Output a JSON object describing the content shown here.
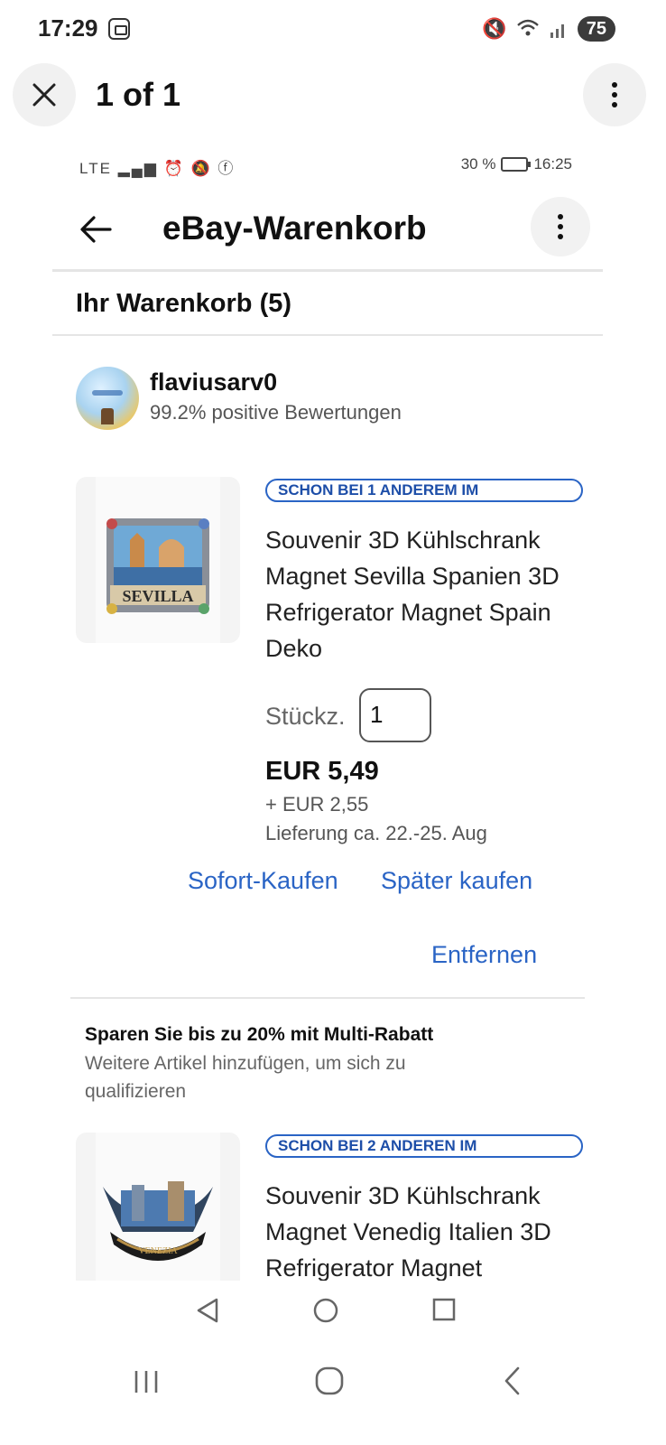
{
  "outer_status": {
    "time": "17:29",
    "battery": "75"
  },
  "viewer": {
    "title": "1 of 1"
  },
  "inner_status": {
    "signal": "LTE",
    "battery": "30 %",
    "time": "16:25"
  },
  "header": {
    "title": "eBay-Warenkorb"
  },
  "cart": {
    "title": "Ihr Warenkorb (5)"
  },
  "seller": {
    "name": "flaviusarv0",
    "rating": "99.2% positive Bewertungen"
  },
  "items": [
    {
      "badge": "SCHON BEI 1 ANDEREM IM",
      "title": "Souvenir 3D Kühlschrank Magnet Sevilla Spanien 3D Refrigerator Magnet Spain Deko",
      "image_label": "SEVILLA",
      "qty_label": "Stückz.",
      "qty": "1",
      "price": "EUR 5,49",
      "shipping": "+ EUR 2,55",
      "delivery": "Lieferung ca. 22.-25. Aug",
      "buy_now": "Sofort-Kaufen",
      "later": "Später kaufen",
      "remove": "Entfernen"
    },
    {
      "badge": "SCHON BEI 2 ANDEREN IM",
      "title": "Souvenir 3D Kühlschrank Magnet Venedig Italien 3D Refrigerator Magnet",
      "image_label": "VENEZIA"
    }
  ],
  "promo": {
    "title": "Sparen Sie bis zu 20% mit Multi-Rabatt",
    "text": "Weitere Artikel hinzufügen, um sich zu qualifizieren"
  },
  "colors": {
    "link": "#2a64c5",
    "badge_border": "#2a64c5",
    "text": "#111111"
  }
}
